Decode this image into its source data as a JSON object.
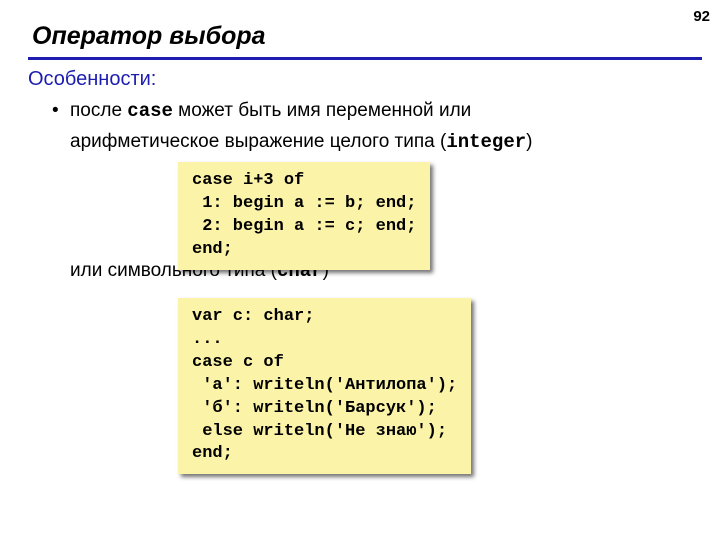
{
  "page_number": "92",
  "title": "Оператор выбора",
  "subheading": "Особенности:",
  "bullet_line1_pre": "после ",
  "bullet_line1_code": "case",
  "bullet_line1_post": " может быть имя переменной или",
  "bullet_line2_pre": "арифметическое выражение целого типа (",
  "bullet_line2_code": "integer",
  "bullet_line2_post": ")",
  "code1": "case i+3 of\n 1: begin a := b; end;\n 2: begin a := c; end;\nend;",
  "mid_pre": "или символьного типа (",
  "mid_code": "char",
  "mid_post": ")",
  "code2": "var c: char;\n...\ncase c of\n 'а': writeln('Антилопа');\n 'б': writeln('Барсук');\n else writeln('Не знаю');\nend;"
}
